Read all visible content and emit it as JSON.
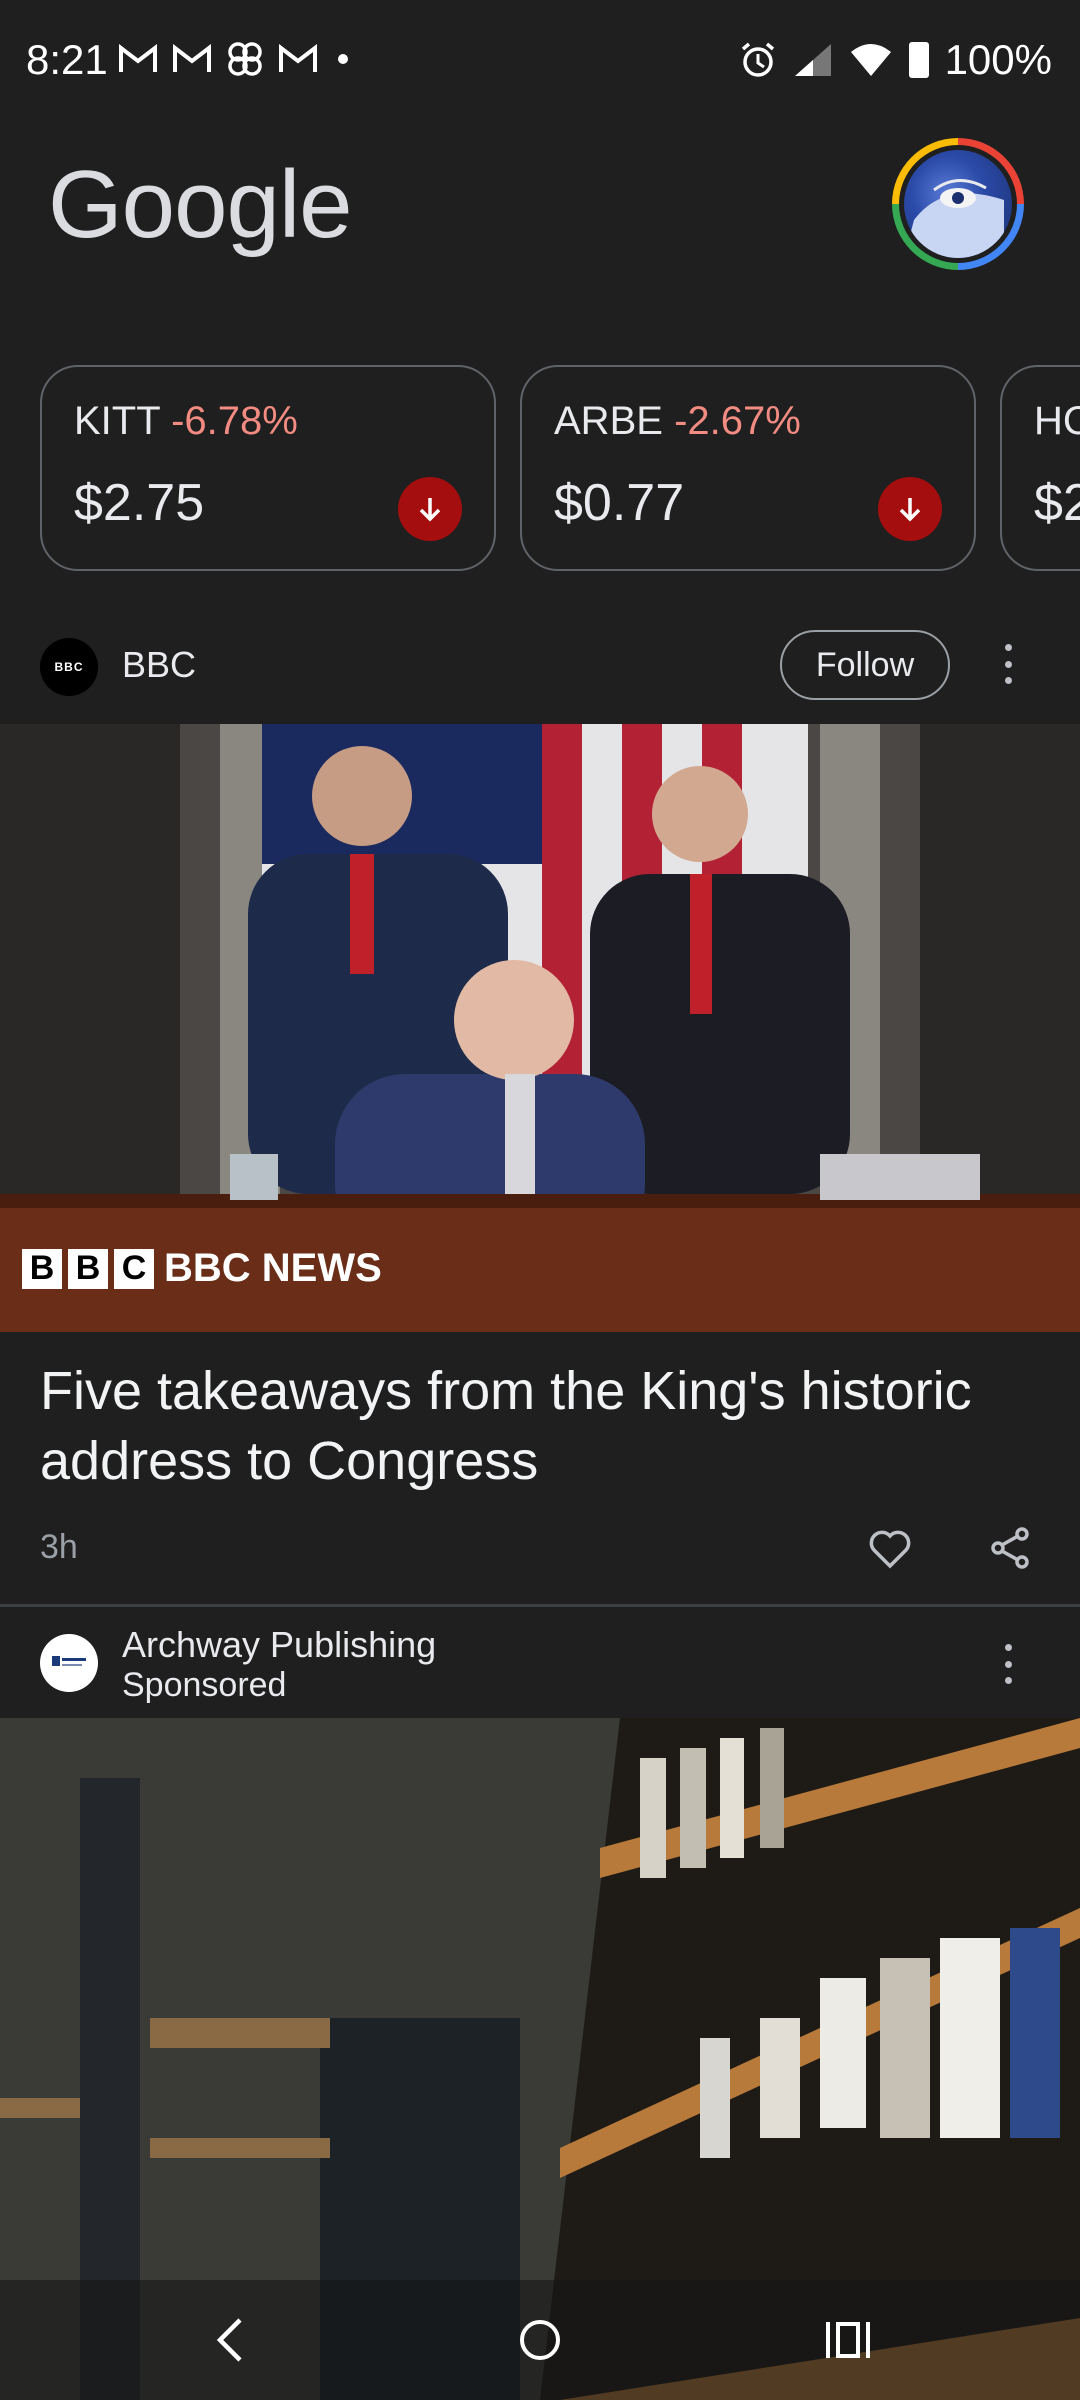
{
  "status_bar": {
    "time": "8:21",
    "notification_icons": [
      "gmail-icon",
      "gmail-icon",
      "pinwheel-icon",
      "gmail-icon"
    ],
    "battery": "100%"
  },
  "header": {
    "logo_text": "Google"
  },
  "stocks": [
    {
      "symbol": "KITT",
      "change": "-6.78%",
      "price": "$2.75"
    },
    {
      "symbol": "ARBE",
      "change": "-2.67%",
      "price": "$0.77"
    },
    {
      "symbol": "HC",
      "change": "",
      "price": "$2"
    }
  ],
  "article": {
    "source": "BBC",
    "source_logo_text": "BBC",
    "follow_label": "Follow",
    "image_caption": "BBC NEWS",
    "title": "Five takeaways from the King's historic address to Congress",
    "time": "3h"
  },
  "sponsored": {
    "name": "Archway Publishing",
    "label": "Sponsored"
  },
  "colors": {
    "background": "#1f1f1f",
    "negative": "#f28b82",
    "down_badge": "#a50e0e"
  }
}
